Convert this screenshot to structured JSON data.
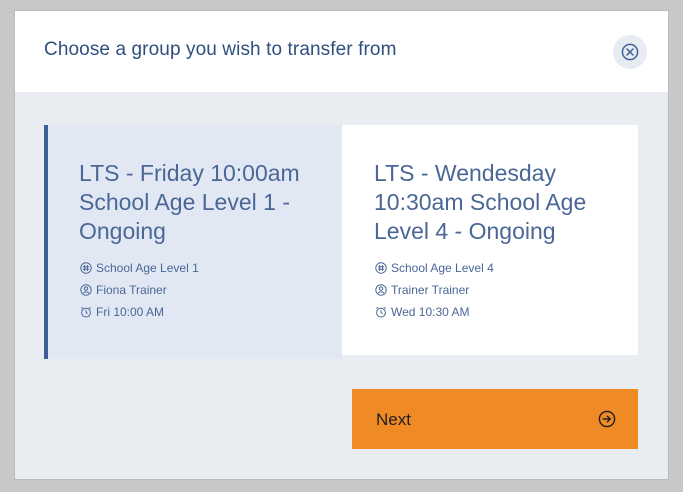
{
  "dialog": {
    "title": "Choose a group you wish to transfer from",
    "close_icon": "close-circle-icon"
  },
  "groups": [
    {
      "title": "LTS - Friday 10:00am School Age Level 1 - Ongoing",
      "selected": true,
      "level": "School Age Level 1",
      "level_icon": "hash-circle-icon",
      "trainer": "Fiona Trainer",
      "trainer_icon": "person-circle-icon",
      "time": "Fri 10:00 AM",
      "time_icon": "alarm-clock-icon"
    },
    {
      "title": "LTS - Wendesday 10:30am School Age Level 4 - Ongoing",
      "selected": false,
      "level": "School Age Level 4",
      "level_icon": "hash-circle-icon",
      "trainer": "Trainer Trainer",
      "trainer_icon": "person-circle-icon",
      "time": "Wed 10:30 AM",
      "time_icon": "alarm-clock-icon"
    }
  ],
  "next_button": {
    "label": "Next",
    "icon": "arrow-right-circle-icon"
  },
  "colors": {
    "accent": "#f08a24",
    "primary_text": "#4a6796",
    "selected_bg": "#e2e8f3",
    "selected_border": "#3d5f98",
    "modal_bg": "#e9ecf1"
  }
}
